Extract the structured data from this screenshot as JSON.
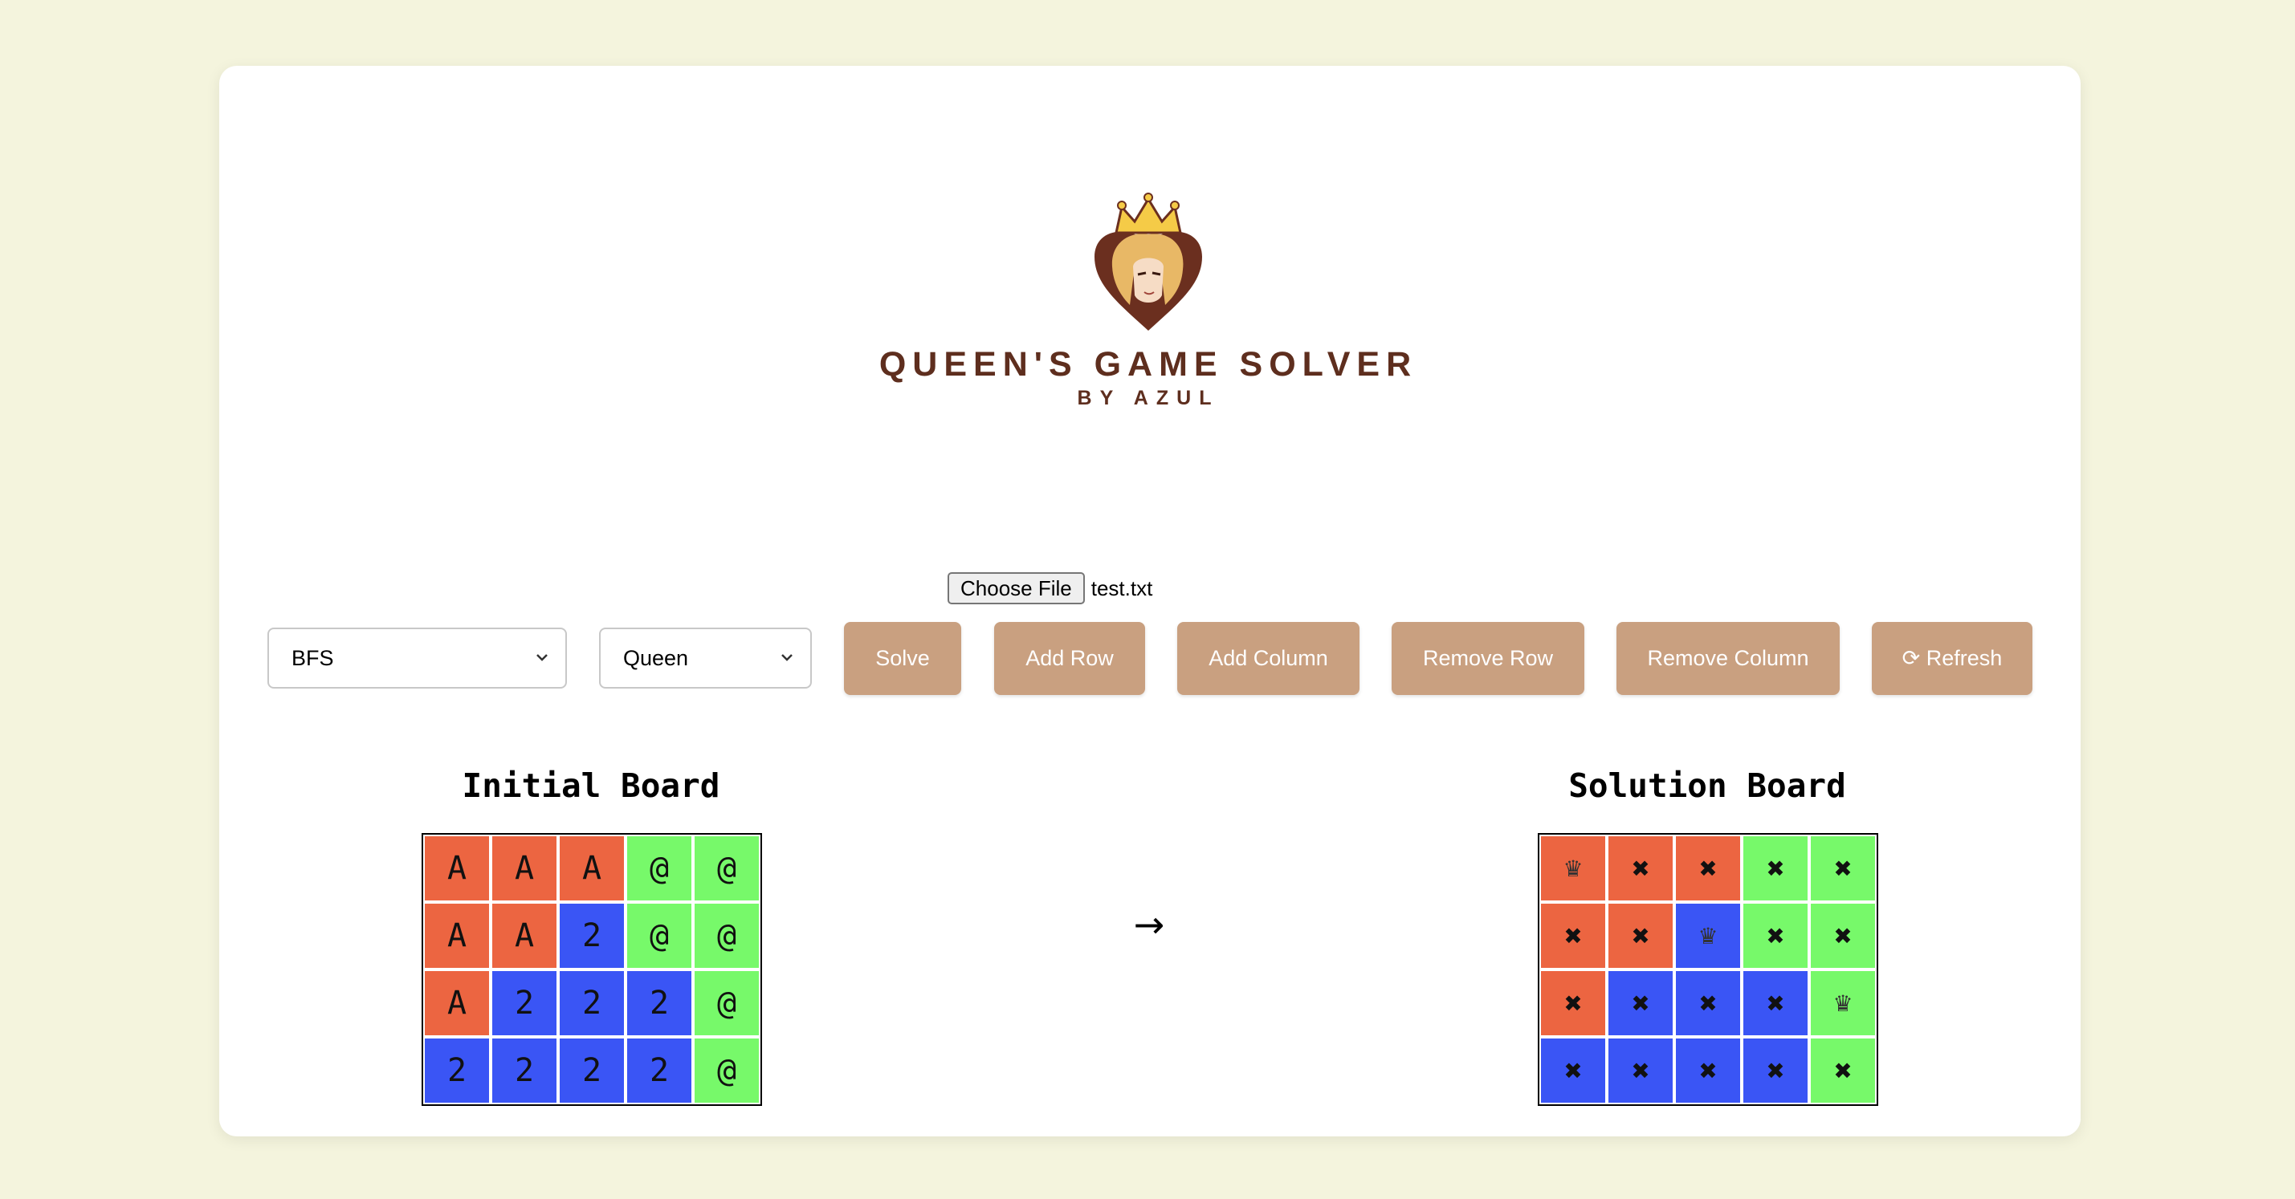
{
  "header": {
    "title": "QUEEN'S GAME SOLVER",
    "subtitle": "BY AZUL"
  },
  "file_input": {
    "button_label": "Choose File",
    "file_name": "test.txt"
  },
  "controls": {
    "algorithm_select": {
      "selected": "BFS"
    },
    "piece_select": {
      "selected": "Queen"
    },
    "buttons": {
      "solve": "Solve",
      "add_row": "Add Row",
      "add_column": "Add Column",
      "remove_row": "Remove Row",
      "remove_column": "Remove Column",
      "refresh": "⟳ Refresh"
    }
  },
  "colors": {
    "A": "#ec6541",
    "2": "#3a55f5",
    "@": "#77f96a",
    "button": "#c9a080",
    "background": "#f4f4dd",
    "title": "#5e2e1e"
  },
  "initial_board": {
    "title": "Initial Board",
    "rows": [
      [
        "A",
        "A",
        "A",
        "@",
        "@"
      ],
      [
        "A",
        "A",
        "2",
        "@",
        "@"
      ],
      [
        "A",
        "2",
        "2",
        "2",
        "@"
      ],
      [
        "2",
        "2",
        "2",
        "2",
        "@"
      ]
    ]
  },
  "arrow": "→",
  "solution_board": {
    "title": "Solution Board",
    "rows": [
      [
        "♛",
        "✖",
        "✖",
        "✖",
        "✖"
      ],
      [
        "✖",
        "✖",
        "♛",
        "✖",
        "✖"
      ],
      [
        "✖",
        "✖",
        "✖",
        "✖",
        "♛"
      ],
      [
        "✖",
        "✖",
        "✖",
        "✖",
        "✖"
      ]
    ]
  }
}
